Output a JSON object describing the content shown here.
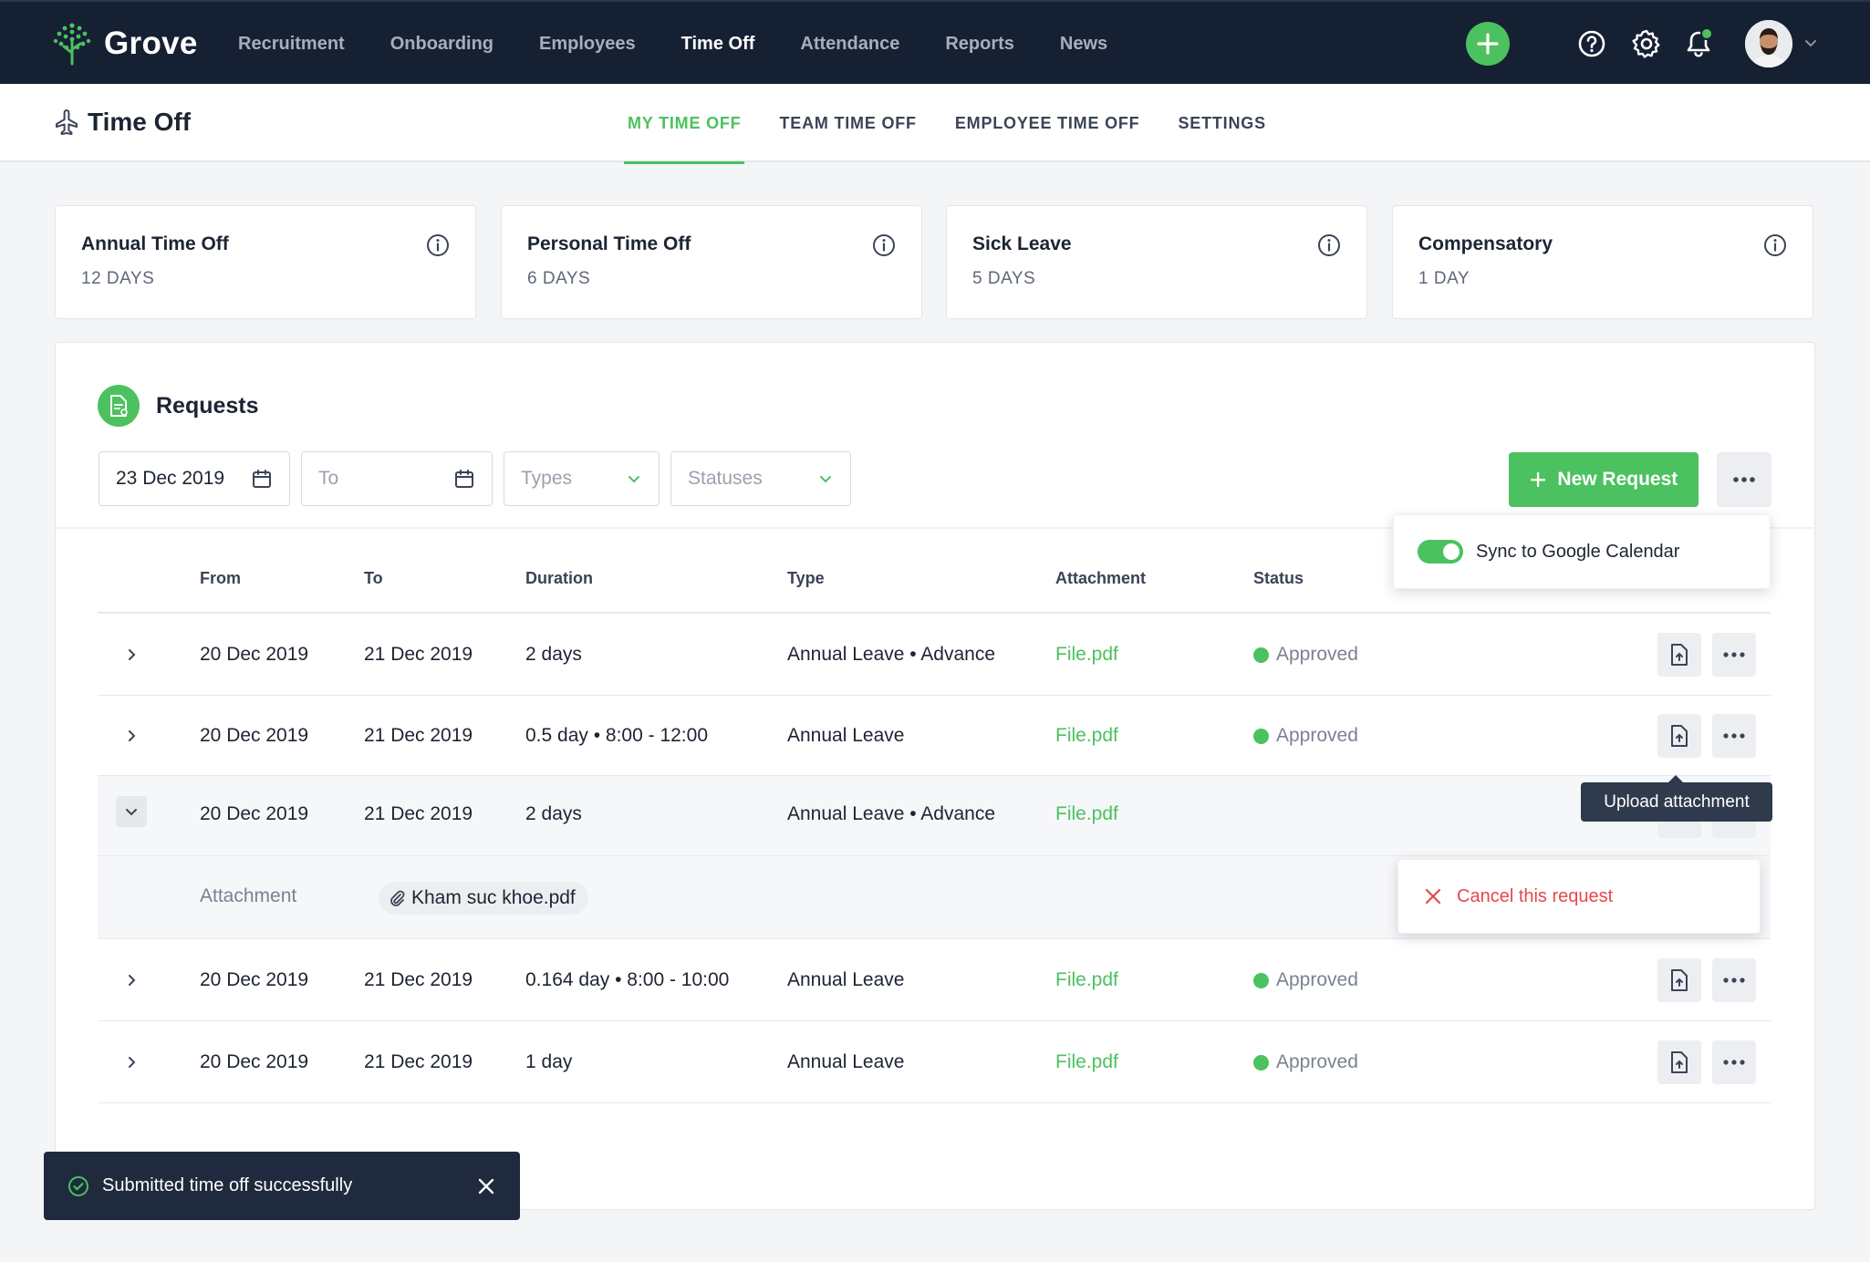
{
  "app": {
    "name": "Grove"
  },
  "nav": {
    "items": [
      {
        "label": "Recruitment"
      },
      {
        "label": "Onboarding"
      },
      {
        "label": "Employees"
      },
      {
        "label": "Time Off",
        "active": true
      },
      {
        "label": "Attendance"
      },
      {
        "label": "Reports"
      },
      {
        "label": "News"
      }
    ],
    "icons": [
      "plus-icon",
      "help-icon",
      "gear-icon",
      "bell-icon",
      "avatar",
      "chevron-down-icon"
    ]
  },
  "page": {
    "title": "Time Off",
    "icon": "airplane-icon"
  },
  "tabs": [
    {
      "label": "MY TIME OFF",
      "active": true
    },
    {
      "label": "TEAM TIME OFF"
    },
    {
      "label": "EMPLOYEE TIME OFF"
    },
    {
      "label": "SETTINGS"
    }
  ],
  "cards": [
    {
      "title": "Annual Time Off",
      "value": "12 DAYS"
    },
    {
      "title": "Personal Time Off",
      "value": "6 DAYS"
    },
    {
      "title": "Sick Leave",
      "value": "5 DAYS"
    },
    {
      "title": "Compensatory",
      "value": "1 DAY"
    }
  ],
  "requests": {
    "title": "Requests",
    "filters": {
      "from_value": "23 Dec 2019",
      "to_placeholder": "To",
      "types_placeholder": "Types",
      "statuses_placeholder": "Statuses"
    },
    "new_request_label": "New Request",
    "sync_label": "Sync to Google Calendar",
    "columns": [
      "From",
      "To",
      "Duration",
      "Type",
      "Attachment",
      "Status"
    ],
    "rows": [
      {
        "from": "20 Dec 2019",
        "to": "21 Dec 2019",
        "duration": "2 days",
        "type": "Annual Leave • Advance",
        "attachment": "File.pdf",
        "status": "Approved"
      },
      {
        "from": "20 Dec 2019",
        "to": "21 Dec 2019",
        "duration": "0.5 day • 8:00 - 12:00",
        "type": "Annual Leave",
        "attachment": "File.pdf",
        "status": "Approved"
      },
      {
        "from": "20 Dec 2019",
        "to": "21 Dec 2019",
        "duration": "2 days",
        "type": "Annual Leave • Advance",
        "attachment": "File.pdf",
        "status": ""
      },
      {
        "from": "20 Dec 2019",
        "to": "21 Dec 2019",
        "duration": "0.164 day • 8:00 - 10:00",
        "type": "Annual Leave",
        "attachment": "File.pdf",
        "status": "Approved"
      },
      {
        "from": "20 Dec 2019",
        "to": "21 Dec 2019",
        "duration": "1 day",
        "type": "Annual Leave",
        "attachment": "File.pdf",
        "status": "Approved"
      }
    ],
    "expanded": {
      "label": "Attachment",
      "file": "Kham suc khoe.pdf"
    },
    "tooltip": "Upload attachment",
    "menu_cancel": "Cancel this request"
  },
  "toast": {
    "message": "Submitted time off successfully"
  },
  "colors": {
    "navy": "#162033",
    "green": "#4cc15f",
    "danger": "#e5484d"
  }
}
